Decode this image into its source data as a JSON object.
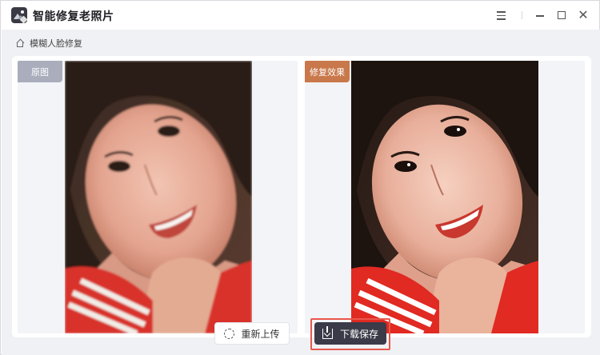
{
  "app": {
    "title": "智能修复老照片"
  },
  "breadcrumb": {
    "label": "模糊人脸修复"
  },
  "comparison": {
    "original_tag": "原图",
    "result_tag": "修复效果"
  },
  "actions": {
    "reupload_label": "重新上传",
    "download_label": "下载保存"
  },
  "colors": {
    "accent_dark": "#3a3a48",
    "result_tag": "#c9784b",
    "original_tag": "#a9adbc",
    "highlight_border": "#e9574b"
  },
  "icons": {
    "app": "app-photo-icon",
    "menu": "hamburger-menu-icon",
    "minimize": "minimize-icon",
    "maximize": "maximize-icon",
    "close": "close-icon",
    "home": "home-icon",
    "reupload": "reload-icon",
    "download": "download-icon"
  }
}
